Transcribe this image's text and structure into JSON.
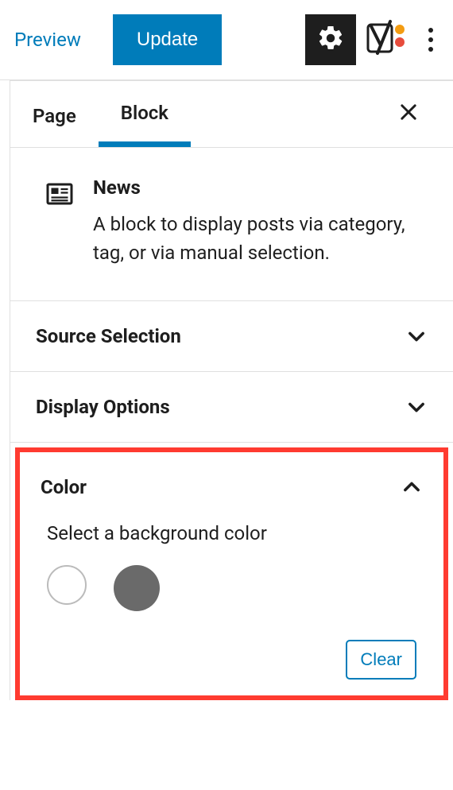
{
  "toolbar": {
    "preview": "Preview",
    "update": "Update"
  },
  "tabs": {
    "page": "Page",
    "block": "Block"
  },
  "block": {
    "title": "News",
    "description": "A block to display posts via category, tag, or via manual selection."
  },
  "panels": {
    "source_selection": "Source Selection",
    "display_options": "Display Options",
    "color": {
      "title": "Color",
      "select_label": "Select a background color",
      "clear": "Clear",
      "swatches": [
        {
          "name": "white",
          "hex": "#ffffff"
        },
        {
          "name": "gray",
          "hex": "#6a6a6a"
        }
      ]
    }
  }
}
